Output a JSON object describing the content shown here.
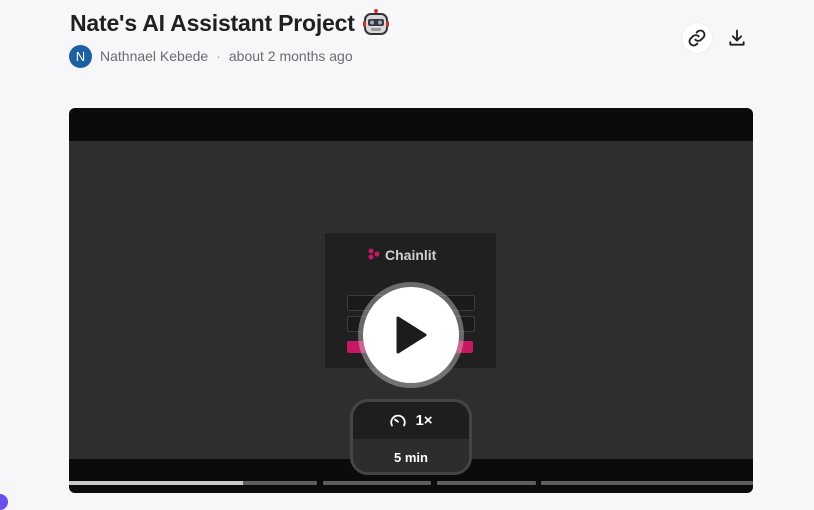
{
  "page": {
    "title": "Nate's AI Assistant Project",
    "title_emoji_icon": "robot-icon"
  },
  "author": {
    "initial": "N",
    "name": "Nathnael Kebede",
    "separator": "·",
    "time": "about 2 months ago",
    "avatar_color": "#1c5fa3"
  },
  "actions": {
    "copy_link_icon": "link-icon",
    "download_icon": "download-icon"
  },
  "video": {
    "thumbnail": {
      "logo_text": "Chainlit",
      "accent": "#c81864"
    },
    "play_icon": "play-icon",
    "playback_speed": "1×",
    "speed_icon": "speedometer-icon",
    "duration": "5 min",
    "progress": {
      "watched_fraction_of_first_segment": 0.7,
      "segment_count": 4
    }
  }
}
